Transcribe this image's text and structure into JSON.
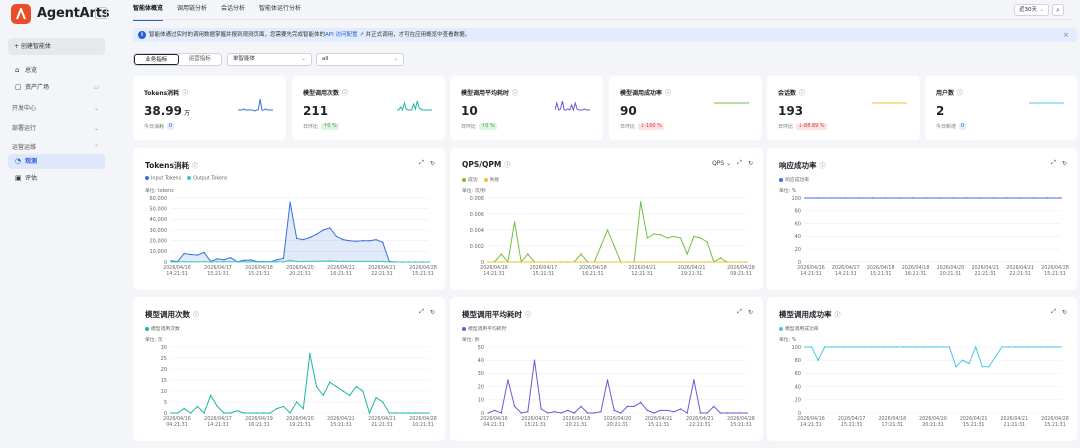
{
  "app": {
    "name": "AgentArts"
  },
  "sidebar": {
    "create_label": "+ 创建智能体",
    "items": [
      {
        "label": "总览",
        "icon": "home-icon"
      },
      {
        "label": "资产广场",
        "icon": "grid-icon"
      }
    ],
    "sections": [
      {
        "label": "开发中心"
      },
      {
        "label": "部署运行"
      },
      {
        "label": "运营运维"
      }
    ],
    "sub_items": [
      {
        "label": "观测",
        "icon": "chart-icon",
        "active": true
      },
      {
        "label": "评估",
        "icon": "evaluation-icon",
        "active": false
      }
    ]
  },
  "header": {
    "tabs": [
      {
        "label": "智能体概览",
        "active": true
      },
      {
        "label": "调用链分析",
        "active": false
      },
      {
        "label": "会话分析",
        "active": false
      },
      {
        "label": "智能体运行分析",
        "active": false
      }
    ],
    "time_range": "近30天"
  },
  "notice": {
    "text_before": "智能体通过实时的调用数据掌握并报到观测页面，您需要先完成智能体的",
    "link": "API 访问配置",
    "text_after": "并正式调用，才可在应用概览中查看数据。"
  },
  "filters": {
    "segments": [
      {
        "label": "业务指标",
        "active": true
      },
      {
        "label": "运营指标",
        "active": false
      }
    ],
    "agent_select": "单智能体",
    "scope_select": "all"
  },
  "kpis": [
    {
      "title": "Tokens消耗",
      "value": "38.99",
      "unit": "万",
      "sub_label": "今日消耗",
      "badge": "0",
      "badge_type": "blue",
      "color": "#3b6fe0",
      "spark": [
        3,
        3,
        3,
        4,
        3,
        3,
        3,
        3,
        3,
        2,
        3,
        3,
        14,
        3,
        3,
        4,
        3,
        3,
        3,
        3
      ]
    },
    {
      "title": "模型调用次数",
      "value": "211",
      "unit": "",
      "sub_label": "日环比",
      "badge": "↑0 %",
      "badge_type": "green",
      "color": "#1fb5a5",
      "spark": [
        3,
        3,
        6,
        3,
        10,
        4,
        3,
        3,
        3,
        9,
        4,
        12,
        5,
        4,
        3,
        3,
        3,
        3,
        3,
        3
      ]
    },
    {
      "title": "模型调用平均耗时",
      "value": "10",
      "unit": "",
      "sub_label": "日环比",
      "badge": "↑0 %",
      "badge_type": "green",
      "color": "#6f55d9",
      "spark": [
        3,
        10,
        3,
        4,
        12,
        3,
        3,
        4,
        3,
        8,
        3,
        10,
        4,
        3,
        3,
        3,
        4,
        3,
        3,
        3
      ]
    },
    {
      "title": "模型调用成功率",
      "value": "90",
      "unit": "",
      "sub_label": "日环比",
      "badge": "↓-100 %",
      "badge_type": "red",
      "color": "#6fc23f",
      "spark": [
        10,
        10,
        10,
        10,
        10,
        10,
        10,
        10,
        10,
        10,
        10,
        10,
        10,
        10,
        10,
        10,
        10,
        10,
        10,
        10
      ]
    },
    {
      "title": "会话数",
      "value": "193",
      "unit": "",
      "sub_label": "日环比",
      "badge": "↓-88.89 %",
      "badge_type": "red",
      "color": "#f0c233",
      "spark": [
        10,
        10,
        10,
        10,
        10,
        10,
        10,
        10,
        10,
        10,
        10,
        10,
        10,
        10,
        10,
        10,
        10,
        10,
        10,
        10
      ]
    },
    {
      "title": "用户数",
      "value": "2",
      "unit": "",
      "sub_label": "今日新增",
      "badge": "0",
      "badge_type": "blue",
      "color": "#4ac4e8",
      "spark": [
        10,
        10,
        10,
        10,
        10,
        10,
        10,
        10,
        10,
        10,
        10,
        10,
        10,
        10,
        10,
        10,
        10,
        10,
        10,
        10
      ]
    }
  ],
  "chart_data": [
    {
      "type": "area",
      "title": "Tokens消耗",
      "unit_label": "单位: tokens",
      "series": [
        {
          "name": "Input Tokens",
          "color": "#3b6fe0",
          "values": [
            1000,
            500,
            8000,
            7000,
            6500,
            9000,
            500,
            3000,
            2000,
            4000,
            300,
            1500,
            2000,
            500,
            500,
            200,
            2000,
            3500,
            56000,
            22000,
            21000,
            23000,
            26000,
            30000,
            32000,
            24000,
            21000,
            20000,
            19500,
            20000,
            20000,
            21000,
            18500,
            500,
            0,
            0,
            0,
            0,
            0,
            0
          ]
        },
        {
          "name": "Output Tokens",
          "color": "#3ec7bd",
          "values": [
            100,
            100,
            200,
            200,
            200,
            300,
            100,
            200,
            200,
            200,
            100,
            100,
            200,
            100,
            100,
            100,
            100,
            200,
            1500,
            600,
            500,
            600,
            700,
            800,
            900,
            700,
            600,
            600,
            600,
            600,
            600,
            600,
            500,
            100,
            0,
            0,
            0,
            0,
            0,
            0
          ]
        }
      ],
      "yticks": [
        "60,000",
        "50,000",
        "40,000",
        "30,000",
        "20,000",
        "10,000",
        "0"
      ],
      "ylim": [
        0,
        60000
      ],
      "xticks": [
        [
          "2026/04/16",
          "14:21:31"
        ],
        [
          "2026/04/17",
          "15:21:31"
        ],
        [
          "2026/04/18",
          "15:21:31"
        ],
        [
          "2026/04/20",
          "20:21:31"
        ],
        [
          "2026/04/21",
          "16:21:31"
        ],
        [
          "2026/04/21",
          "22:21:31"
        ],
        [
          "2026/04/28",
          "15:21:31"
        ]
      ]
    },
    {
      "type": "line",
      "title": "QPS/QPM",
      "unit_label": "单位: 次/秒",
      "select": "QPS",
      "series": [
        {
          "name": "成功",
          "color": "#6fc23f",
          "values": [
            0,
            0,
            0.001,
            0,
            0.005,
            0,
            0.001,
            0,
            0,
            0,
            0,
            0,
            0,
            0,
            0.001,
            0,
            0,
            0.002,
            0.004,
            0.002,
            0,
            0,
            0,
            0.0075,
            0.003,
            0.0035,
            0.0034,
            0.003,
            0.0032,
            0.003,
            0.001,
            0.0032,
            0.003,
            0.0025,
            0,
            0.0005,
            0,
            0,
            0,
            0
          ]
        },
        {
          "name": "失败",
          "color": "#f0c233",
          "values": [
            0,
            0,
            0,
            0,
            0,
            0,
            0,
            0,
            0,
            0,
            0,
            0,
            0,
            0,
            0,
            0,
            0,
            0,
            0,
            0,
            0,
            0,
            0,
            0,
            0,
            0,
            0,
            0,
            0,
            0,
            0,
            0,
            0,
            0,
            0,
            0,
            0,
            0,
            0,
            0
          ]
        }
      ],
      "yticks": [
        "0.008",
        "0.006",
        "0.004",
        "0.002",
        "0"
      ],
      "ylim": [
        0,
        0.008
      ],
      "xticks": [
        [
          "2026/04/16",
          "14:21:31"
        ],
        [
          "2026/04/17",
          "15:21:31"
        ],
        [
          "2026/04/18",
          "16:21:31"
        ],
        [
          "2026/04/21",
          "12:21:31"
        ],
        [
          "2026/04/21",
          "19:21:31"
        ],
        [
          "2026/04/28",
          "09:21:31"
        ]
      ]
    },
    {
      "type": "line",
      "title": "响应成功率",
      "unit_label": "单位: %",
      "series": [
        {
          "name": "响应成功率",
          "color": "#3b6fe0",
          "values": [
            100,
            100,
            100,
            100,
            100,
            100,
            100,
            100,
            100,
            100,
            100,
            100,
            100,
            100,
            100,
            100,
            100,
            100,
            100,
            100
          ]
        }
      ],
      "yticks": [
        "100",
        "80",
        "60",
        "40",
        "20",
        "0"
      ],
      "ylim": [
        0,
        100
      ],
      "xticks": [
        [
          "2026/04/16",
          "14:21:31"
        ],
        [
          "2026/04/17",
          "14:21:31"
        ],
        [
          "2026/04/18",
          "15:21:31"
        ],
        [
          "2026/04/18",
          "16:21:31"
        ],
        [
          "2026/04/20",
          "20:21:31"
        ],
        [
          "2026/04/21",
          "21:21:31"
        ],
        [
          "2026/04/21",
          "22:21:31"
        ],
        [
          "2026/04/28",
          "15:21:31"
        ]
      ]
    },
    {
      "type": "line",
      "title": "模型调用次数",
      "unit_label": "单位: 次",
      "series": [
        {
          "name": "模型调用次数",
          "color": "#1fb5a5",
          "values": [
            0,
            0,
            2,
            0,
            3,
            0,
            8,
            3,
            0,
            0,
            1,
            0,
            0,
            0,
            0,
            0,
            2,
            3,
            0,
            5,
            2,
            27,
            12,
            8,
            14,
            12,
            10,
            8,
            12,
            10,
            0,
            7,
            5,
            0,
            0,
            0,
            0,
            0,
            0,
            0
          ]
        }
      ],
      "yticks": [
        "30",
        "25",
        "20",
        "15",
        "10",
        "5",
        "0"
      ],
      "ylim": [
        0,
        30
      ],
      "xticks": [
        [
          "2026/04/16",
          "04:21:31"
        ],
        [
          "2026/04/17",
          "14:21:31"
        ],
        [
          "2026/04/19",
          "16:21:31"
        ],
        [
          "2026/04/20",
          "19:21:31"
        ],
        [
          "2026/04/21",
          "15:21:31"
        ],
        [
          "2026/04/21",
          "21:21:31"
        ],
        [
          "2026/04/28",
          "10:21:31"
        ]
      ]
    },
    {
      "type": "line",
      "title": "模型调用平均耗时",
      "unit_label": "单位: 秒",
      "series": [
        {
          "name": "模型调用平均耗时",
          "color": "#6f55d9",
          "values": [
            0,
            2,
            0,
            25,
            5,
            0,
            1,
            40,
            3,
            0,
            1,
            0,
            2,
            0,
            5,
            0,
            0,
            1,
            25,
            2,
            0,
            5,
            5,
            8,
            2,
            0,
            2,
            2,
            1,
            3,
            0,
            25,
            0,
            0,
            5,
            0,
            0,
            0,
            0,
            0
          ]
        }
      ],
      "yticks": [
        "50",
        "40",
        "30",
        "20",
        "10",
        "0"
      ],
      "ylim": [
        0,
        50
      ],
      "xticks": [
        [
          "2026/04/16",
          "04:21:31"
        ],
        [
          "2026/04/17",
          "15:21:31"
        ],
        [
          "2026/04/18",
          "20:21:31"
        ],
        [
          "2026/04/20",
          "20:21:31"
        ],
        [
          "2026/04/21",
          "15:21:31"
        ],
        [
          "2026/04/21",
          "22:21:31"
        ],
        [
          "2026/04/28",
          "15:21:31"
        ]
      ]
    },
    {
      "type": "line",
      "title": "模型调用成功率",
      "unit_label": "单位: %",
      "series": [
        {
          "name": "模型调用成功率",
          "color": "#4ac4e8",
          "values": [
            100,
            100,
            80,
            100,
            100,
            100,
            100,
            100,
            100,
            100,
            100,
            100,
            100,
            100,
            100,
            100,
            100,
            100,
            100,
            100,
            100,
            100,
            100,
            70,
            80,
            75,
            100,
            70,
            70,
            85,
            100,
            100,
            100,
            100,
            100,
            100,
            100,
            100,
            100,
            100
          ]
        }
      ],
      "yticks": [
        "100",
        "80",
        "60",
        "40",
        "20",
        "0"
      ],
      "ylim": [
        0,
        100
      ],
      "xticks": [
        [
          "2026/04/16",
          "14:21:31"
        ],
        [
          "2026/04/17",
          "15:21:31"
        ],
        [
          "2026/04/18",
          "17:21:31"
        ],
        [
          "2026/04/20",
          "20:21:31"
        ],
        [
          "2026/04/21",
          "15:21:31"
        ],
        [
          "2026/04/21",
          "21:21:31"
        ],
        [
          "2026/04/28",
          "15:21:31"
        ]
      ]
    }
  ]
}
